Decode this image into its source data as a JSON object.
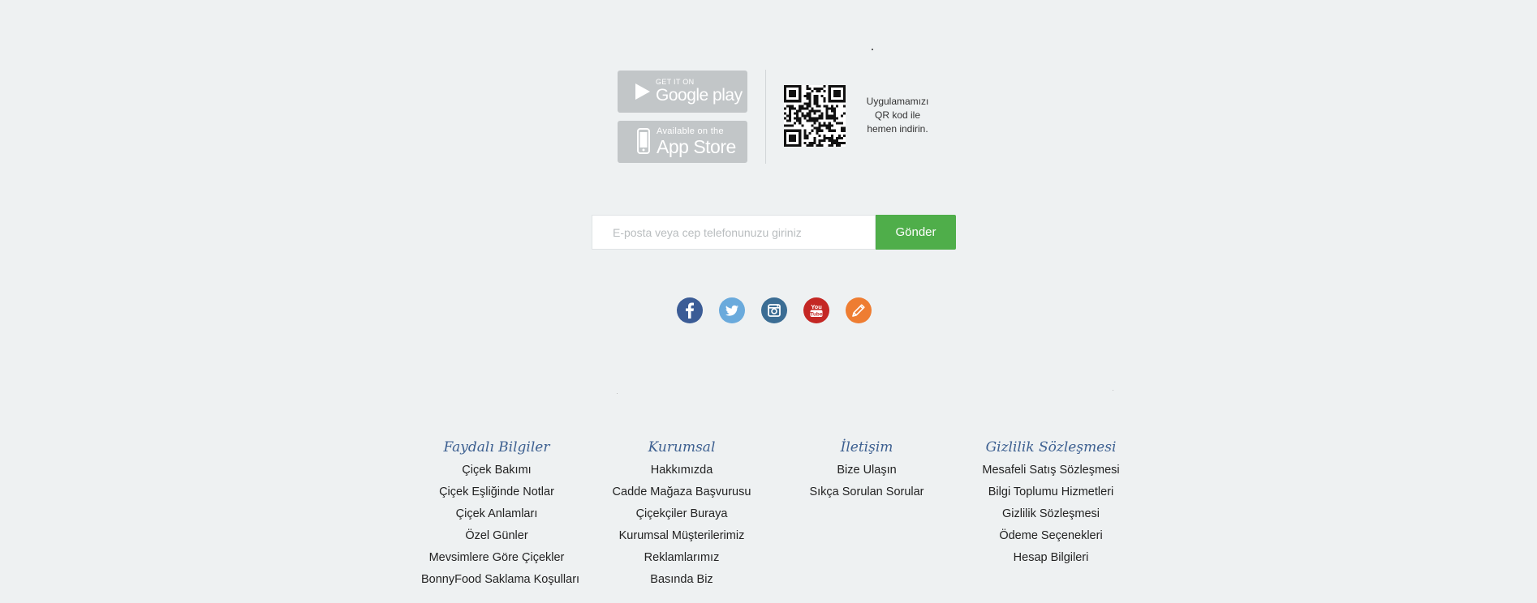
{
  "apps": {
    "google_play": {
      "small": "GET IT ON",
      "big": "Google play"
    },
    "app_store": {
      "small": "Available on the",
      "big": "App Store"
    },
    "qr_text": [
      "Uygulamamızı",
      "QR kod ile",
      "hemen indirin."
    ]
  },
  "newsletter": {
    "placeholder": "E-posta veya cep telefonunuzu giriniz",
    "submit_label": "Gönder"
  },
  "social": [
    {
      "name": "facebook",
      "color": "#3b5c96"
    },
    {
      "name": "twitter",
      "color": "#6aaadc"
    },
    {
      "name": "instagram",
      "color": "#3b6d94"
    },
    {
      "name": "youtube",
      "color": "#c42724"
    },
    {
      "name": "blog",
      "color": "#ee7d32"
    }
  ],
  "footer": {
    "columns": [
      {
        "title": "Faydalı Bilgiler",
        "links": [
          "Çiçek Bakımı",
          "Çiçek Eşliğinde Notlar",
          "Çiçek Anlamları",
          "Özel Günler",
          "Mevsimlere Göre Çiçekler",
          "BonnyFood Saklama Koşulları"
        ]
      },
      {
        "title": "Kurumsal",
        "links": [
          "Hakkımızda",
          "Cadde Mağaza Başvurusu",
          "Çiçekçiler Buraya",
          "Kurumsal Müşterilerimiz",
          "Reklamlarımız",
          "Basında Biz"
        ]
      },
      {
        "title": "İletişim",
        "links": [
          "Bize Ulaşın",
          "Sıkça Sorulan Sorular"
        ]
      },
      {
        "title": "Gizlilik Sözleşmesi",
        "links": [
          "Mesafeli Satış Sözleşmesi",
          "Bilgi Toplumu Hizmetleri",
          "Gizlilik Sözleşmesi",
          "Ödeme Seçenekleri",
          "Hesap Bilgileri"
        ]
      }
    ]
  }
}
